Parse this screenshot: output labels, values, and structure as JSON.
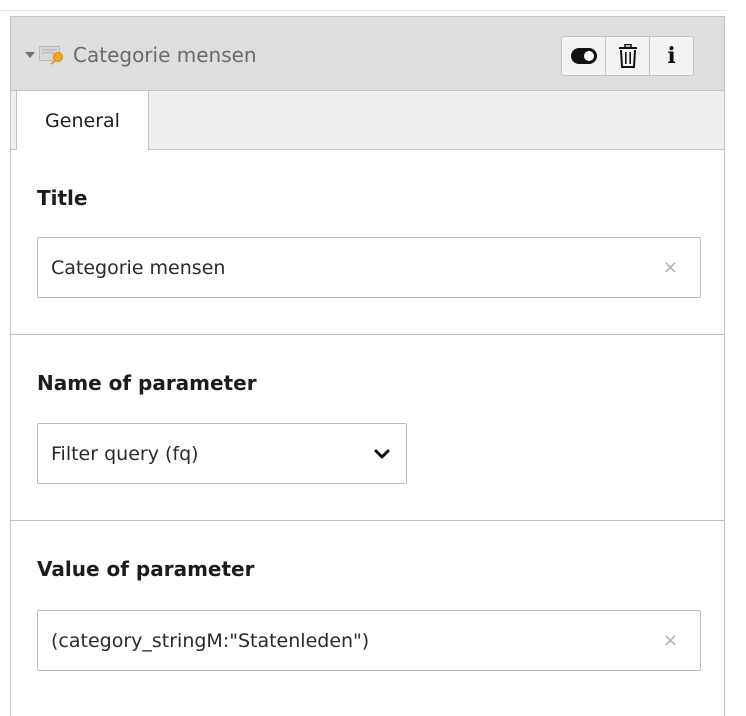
{
  "record": {
    "title": "Categorie mensen",
    "icon": "record-type-icon",
    "actions": [
      {
        "name": "toggle-visibility",
        "icon": "toggle-icon"
      },
      {
        "name": "delete",
        "icon": "trash-icon"
      },
      {
        "name": "info",
        "icon": "info-icon",
        "glyph": "i"
      }
    ]
  },
  "tabs": [
    {
      "label": "General",
      "active": true
    }
  ],
  "fields": {
    "title": {
      "label": "Title",
      "value": "Categorie mensen"
    },
    "parameter_name": {
      "label": "Name of parameter",
      "selected": "Filter query (fq)"
    },
    "parameter_value": {
      "label": "Value of parameter",
      "value": "(category_stringM:\"Statenleden\")"
    }
  },
  "clear_glyph": "×",
  "colors": {
    "header_bg": "#dedede",
    "tab_bar_bg": "#efefef",
    "border": "#c3c3c3",
    "title_text": "#6b6b6b",
    "icon_orange": "#f2a91c"
  }
}
